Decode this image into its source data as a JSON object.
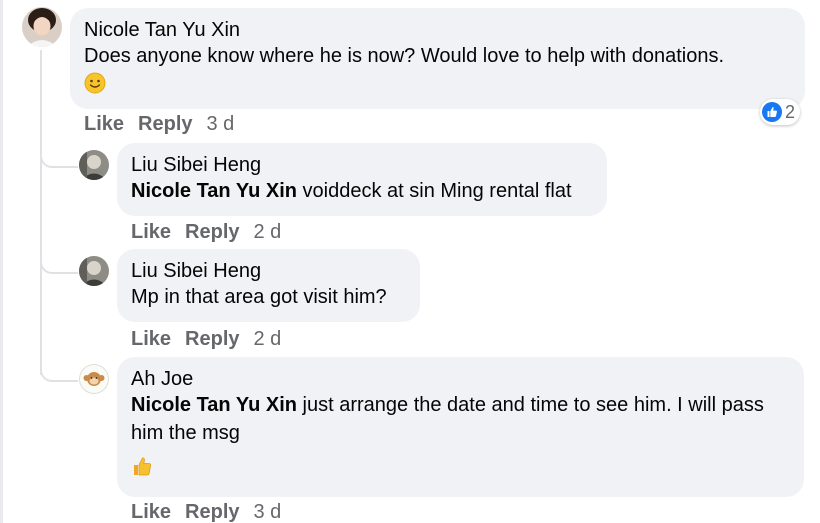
{
  "comments": [
    {
      "author": "Nicole Tan Yu Xin",
      "text": "Does anyone know where he is now? Would love to help with donations.",
      "emoji": "slightly-smiling-face",
      "like": "Like",
      "reply": "Reply",
      "time": "3 d",
      "reaction_count": "2",
      "reaction_icon": "like-icon"
    }
  ],
  "replies": [
    {
      "author": "Liu Sibei Heng",
      "mention": "Nicole Tan Yu Xin",
      "text": " voiddeck at sin Ming rental flat",
      "like": "Like",
      "reply": "Reply",
      "time": "2 d"
    },
    {
      "author": "Liu Sibei Heng",
      "text": "Mp in that area got visit him?",
      "like": "Like",
      "reply": "Reply",
      "time": "2 d"
    },
    {
      "author": "Ah Joe",
      "mention": "Nicole Tan Yu Xin",
      "text": " just arrange the date and time to see him. I will pass him the msg",
      "emoji": "thumbs-up",
      "like": "Like",
      "reply": "Reply",
      "time": "3 d"
    }
  ],
  "colors": {
    "bubble": "#f0f2f5",
    "text": "#050505",
    "secondary_text": "#65676b",
    "like_blue": "#1877f2"
  }
}
